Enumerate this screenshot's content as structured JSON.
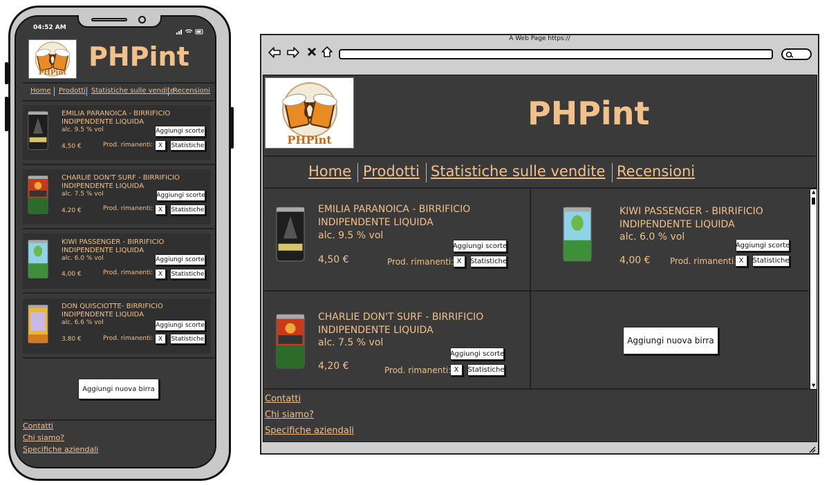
{
  "brand": {
    "name": "PHPint",
    "logo_text": "PHPint"
  },
  "nav": [
    "Home",
    "Prodotti",
    "Statistiche sulle vendite",
    "Recensioni"
  ],
  "mobile": {
    "status_time": "04:52 AM",
    "products": [
      {
        "title": "EMILIA PARANOICA - BIRRIFICIO INDIPENDENTE LIQUIDA",
        "alc": "alc. 9.5 % vol",
        "price": "4,50 €"
      },
      {
        "title": "CHARLIE DON'T SURF - BIRRIFICIO INDIPENDENTE LIQUIDA",
        "alc": "alc. 7.5 % vol",
        "price": "4,20 €"
      },
      {
        "title": "KIWI PASSENGER - BIRRIFICIO INDIPENDENTE LIQUIDA",
        "alc": "alc. 6.0 % vol",
        "price": "4,00 €"
      },
      {
        "title": "DON QUISCIOTTE- BIRRIFICIO INDIPENDENTE LIQUIDA",
        "alc": "alc. 6.6 % vol",
        "price": "3.80 €"
      }
    ]
  },
  "desktop": {
    "window_title": "A Web Page https://",
    "products": [
      {
        "title": "EMILIA PARANOICA - BIRRIFICIO INDIPENDENTE LIQUIDA",
        "alc": "alc. 9.5 % vol",
        "price": "4,50 €"
      },
      {
        "title": "KIWI PASSENGER - BIRRIFICIO INDIPENDENTE LIQUIDA",
        "alc": "alc. 6.0 % vol",
        "price": "4,00 €"
      },
      {
        "title": "CHARLIE DON'T SURF - BIRRIFICIO INDIPENDENTE LIQUIDA",
        "alc": "alc. 7.5 % vol",
        "price": "4,20 €"
      }
    ]
  },
  "labels": {
    "add_stock": "Aggiungi scorte",
    "remaining": "Prod. rimanenti:",
    "remove": "X",
    "stats": "Statistiche",
    "add_beer": "Aggiungi nuova birra"
  },
  "footer": [
    "Contatti",
    "Chi siamo?",
    "Specifiche aziendali"
  ],
  "colors": {
    "accent": "#f2c08a",
    "background": "#3a3a3a",
    "card": "#303030"
  },
  "icons": [
    "back-arrow-icon",
    "forward-arrow-icon",
    "close-icon",
    "home-icon",
    "search-icon",
    "resize-grip-icon",
    "beer-can-icon",
    "beer-mugs-logo"
  ]
}
